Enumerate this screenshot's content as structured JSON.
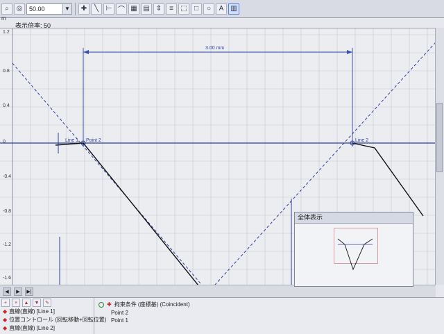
{
  "toolbar": {
    "zoom_value": "50.00",
    "buttons": [
      "search-icon",
      "zoom-icon",
      "cursor-icon",
      "line-icon",
      "dimension-icon",
      "arc-icon",
      "grid-icon",
      "table-icon",
      "measure-icon",
      "align-icon",
      "frame-icon",
      "rect-icon",
      "circle-icon",
      "text-icon",
      "chart-icon"
    ]
  },
  "header": {
    "unit": "m",
    "zoom_label": "表示倍率: 50"
  },
  "axis": {
    "y_ticks": [
      "1.2",
      "0.8",
      "0.4",
      "0",
      "-0.4",
      "-0.8",
      "-1.2",
      "-1.6"
    ]
  },
  "annotations": {
    "dimension": "3.00 mm",
    "line1": "Line 1",
    "point2": "Point 2",
    "line2": "Line 2"
  },
  "overview": {
    "title": "全体表示"
  },
  "tree": {
    "items": [
      "直線(直線) [Line 1]",
      "位置コントロール (回転移動+回転位置)",
      "直線(直線) [Line 2]"
    ]
  },
  "properties": {
    "header": "拘束条件 (座標基)  (Coincident)",
    "lines": [
      "Point 2",
      "Point 1"
    ]
  }
}
